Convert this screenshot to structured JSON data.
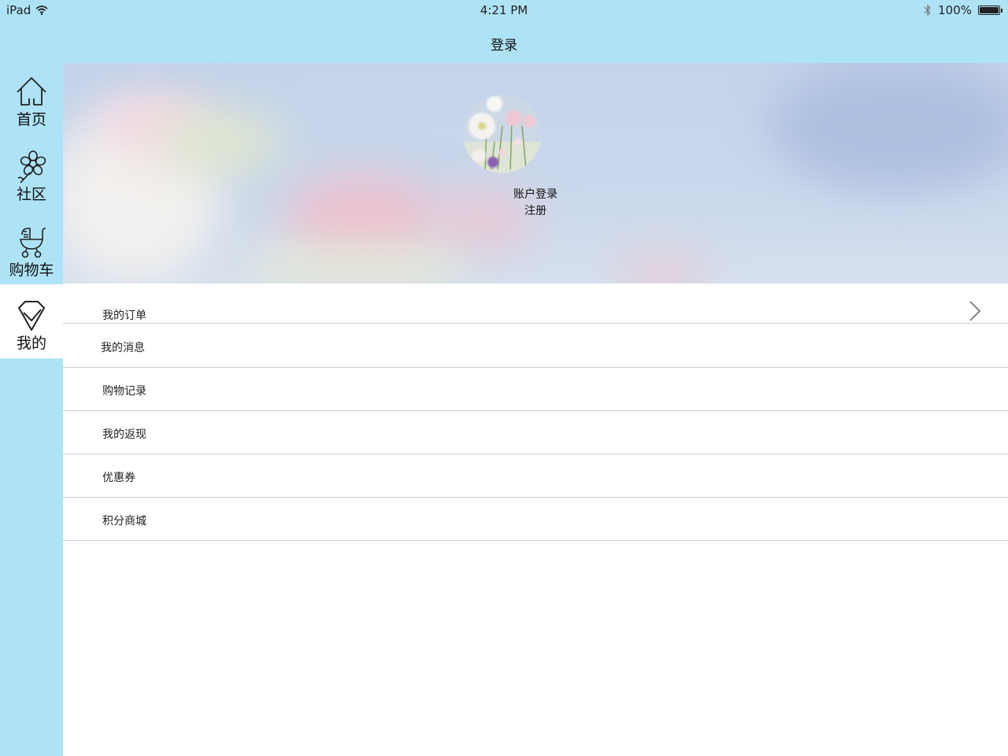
{
  "status_bar": {
    "device": "iPad",
    "time": "4:21 PM",
    "battery": "100%",
    "battery_level": 1.0
  },
  "header": {
    "title": "登录"
  },
  "sidebar": {
    "items": [
      {
        "label": "首页",
        "icon": "home-icon"
      },
      {
        "label": "社区",
        "icon": "flower-icon"
      },
      {
        "label": "购物车",
        "icon": "stroller-icon"
      },
      {
        "label": "我的",
        "icon": "diamond-check-icon",
        "active": true
      }
    ]
  },
  "banner": {
    "login_label": "账户登录",
    "register_label": "注册"
  },
  "menu": {
    "items": [
      {
        "label": "我的订单"
      },
      {
        "label": "我的消息"
      },
      {
        "label": "购物记录"
      },
      {
        "label": "我的返现"
      },
      {
        "label": "优惠券"
      },
      {
        "label": "积分商城"
      }
    ]
  },
  "colors": {
    "accent": "#aee3f7",
    "divider": "#cfcfcf",
    "text": "#222222"
  }
}
